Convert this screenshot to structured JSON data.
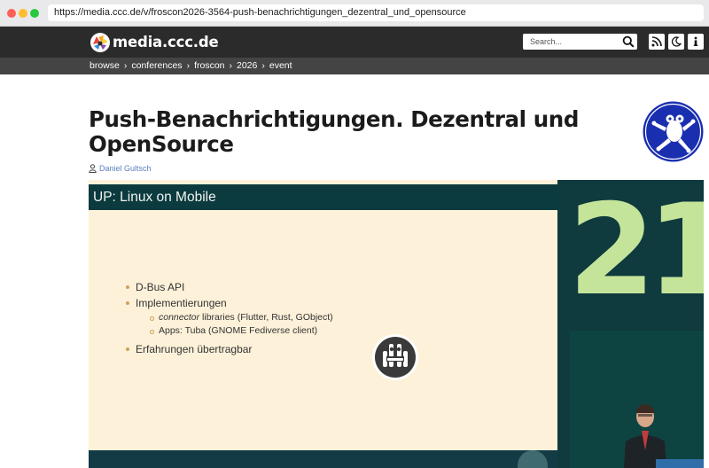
{
  "browser": {
    "url": "https://media.ccc.de/v/froscon2026-3564-push-benachrichtigungen_dezentral_und_opensource"
  },
  "header": {
    "brand": "media.ccc.de",
    "search_placeholder": "Search...",
    "icons": [
      "rss-icon",
      "moon-icon",
      "info-icon",
      "search-icon"
    ]
  },
  "breadcrumb": {
    "items": [
      "browse",
      "conferences",
      "froscon",
      "2026",
      "event"
    ],
    "separator": "›"
  },
  "event": {
    "title": "Push-Benachrichtigungen. Dezentral und OpenSource",
    "speaker": "Daniel Gultsch"
  },
  "slide": {
    "heading": "UP: Linux on Mobile",
    "bullets": {
      "b1": "D-Bus API",
      "b2": "Implementierungen",
      "b2_sub1_em": "connector",
      "b2_sub1_rest": " libraries (Flutter, Rust, GObject)",
      "b2_sub2": "Apps: Tuba (GNOME Fediverse client)",
      "b3": "Erfahrungen übertragbar"
    }
  },
  "stage": {
    "backdrop_text": "21"
  },
  "colors": {
    "header_bg": "#2b2b2b",
    "breadcrumb_bg": "#444444",
    "slide_bg": "#fdf1d9",
    "slide_head_bg": "#0b3b3e",
    "link": "#5b7fbf",
    "conf_logo_bg": "#1a2fb0",
    "backdrop_green": "#c4e49a"
  }
}
